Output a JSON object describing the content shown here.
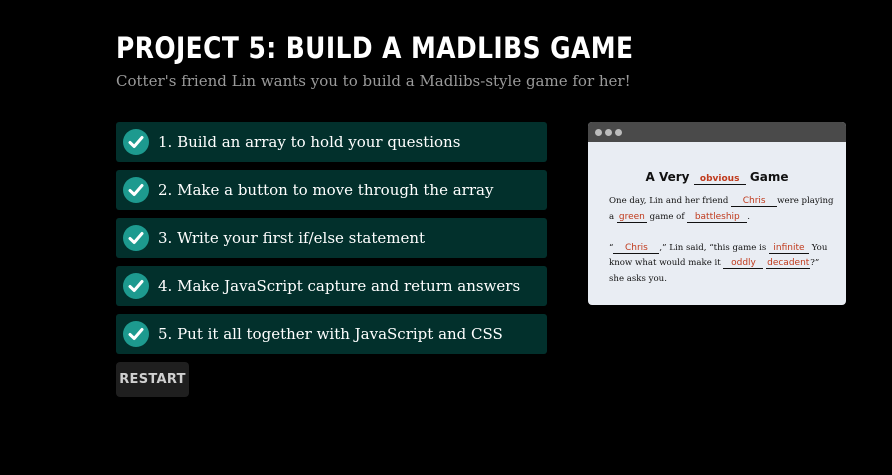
{
  "header": {
    "title": "PROJECT 5: BUILD A MADLIBS GAME",
    "subtitle": "Cotter's friend Lin wants you to build a Madlibs-style game for her!"
  },
  "steps": [
    {
      "label": "1. Build an array to hold your questions",
      "completed": true
    },
    {
      "label": "2. Make a button to move through the array",
      "completed": true
    },
    {
      "label": "3. Write your first if/else statement",
      "completed": true
    },
    {
      "label": "4. Make JavaScript capture and return answers",
      "completed": true
    },
    {
      "label": "5. Put it all together with JavaScript and CSS",
      "completed": true
    }
  ],
  "restart_label": "RESTART",
  "preview": {
    "title_before": "A Very",
    "title_after": "Game",
    "words": {
      "w1": "obvious",
      "w2": "Chris",
      "w3": "green",
      "w4": "battleship",
      "w5": "Chris",
      "w6": "infinite",
      "w7": "oddly",
      "w8": "decadent"
    },
    "text": {
      "t1": "One day, Lin and her friend",
      "t2": "were playing",
      "t3": "a",
      "t4": "game of",
      "t5": ".",
      "t6": "“",
      "t7": ",” Lin said, “this game is",
      "t8": "You",
      "t9": "know what would make it",
      "t10": "?”",
      "t11": "she asks you."
    }
  },
  "colors": {
    "background": "#000000",
    "step_bg": "#02302c",
    "check_bg": "#1d9a8f",
    "filled_word": "#c03a1c"
  }
}
